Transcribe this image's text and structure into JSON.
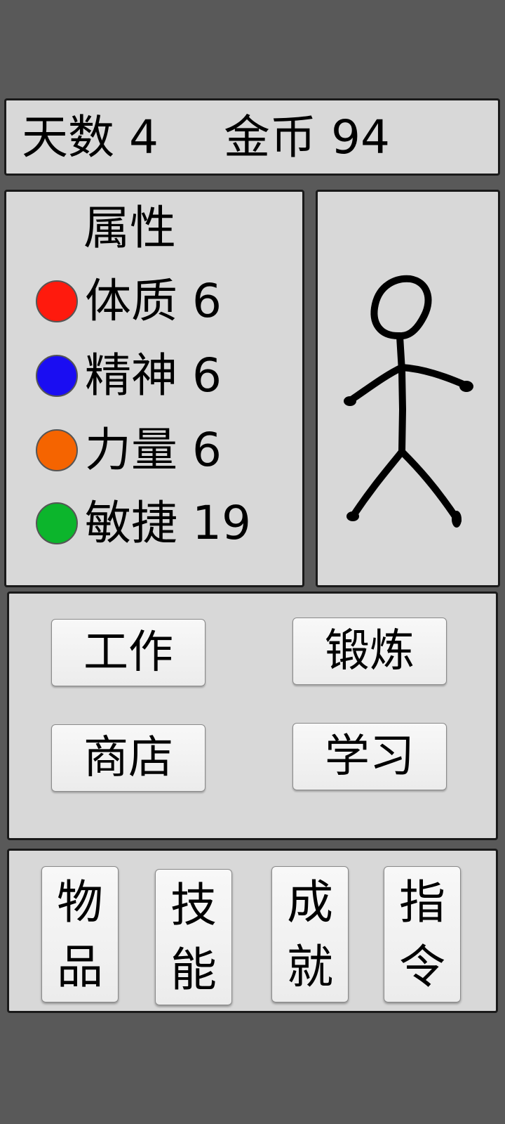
{
  "status": {
    "day_label": "天数",
    "day_value": "4",
    "gold_label": "金币",
    "gold_value": "94"
  },
  "attributes": {
    "title": "属性",
    "items": [
      {
        "name": "体质",
        "value": "6",
        "color": "#ff1a0d"
      },
      {
        "name": "精神",
        "value": "6",
        "color": "#1a0df2"
      },
      {
        "name": "力量",
        "value": "6",
        "color": "#f56400"
      },
      {
        "name": "敏捷",
        "value": "19",
        "color": "#0cb52c"
      }
    ]
  },
  "avatar": {
    "icon": "stick-figure"
  },
  "actions": {
    "work": "工作",
    "train": "锻炼",
    "shop": "商店",
    "study": "学习"
  },
  "menu": {
    "items": {
      "top": "物",
      "bottom": "品"
    },
    "skills": {
      "top": "技",
      "bottom": "能"
    },
    "achievements": {
      "top": "成",
      "bottom": "就"
    },
    "commands": {
      "top": "指",
      "bottom": "令"
    }
  }
}
